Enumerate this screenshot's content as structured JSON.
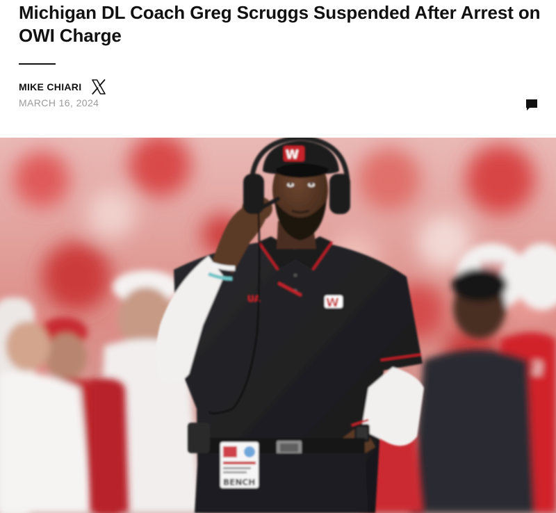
{
  "article": {
    "headline": "Michigan DL Coach Greg Scruggs Suspended After Arrest on OWI Charge",
    "author": "MIKE CHIARI",
    "date": "MARCH 16, 2024"
  },
  "icons": {
    "social": "x-logo-icon",
    "comments": "comment-bubble-icon"
  },
  "hero_image": {
    "alt": "Greg Scruggs on the Wisconsin sideline wearing a headset and a black W polo",
    "badge_text": "BENCH",
    "colors": {
      "crowd_red": "#d9262f",
      "polo_black": "#1f1f22",
      "skin": "#5a3a28"
    }
  }
}
